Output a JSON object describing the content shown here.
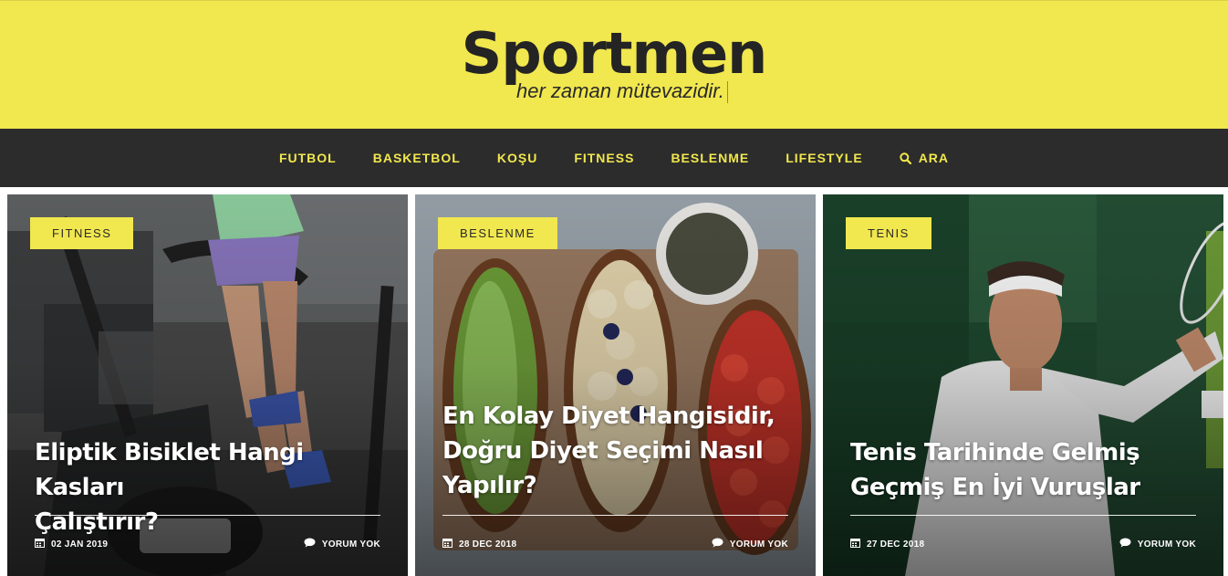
{
  "header": {
    "logo": "Sportmen",
    "tagline": "her zaman mütevazidir."
  },
  "nav": {
    "items": [
      "FUTBOL",
      "BASKETBOL",
      "KOŞU",
      "FITNESS",
      "BESLENME",
      "LIFESTYLE"
    ],
    "search_label": "ARA",
    "search_icon": "search-icon"
  },
  "cards": [
    {
      "category": "FITNESS",
      "title_line1": "Eliptik Bisiklet Hangi Kasları",
      "title_line2": "Çalıştırır?",
      "date": "02 JAN 2019",
      "comments": "YORUM YOK",
      "image": "woman-on-elliptical-machine-in-gym"
    },
    {
      "category": "BESLENME",
      "title_line1": "En Kolay Diyet Hangisidir,",
      "title_line2": "Doğru Diyet Seçimi Nasıl",
      "title_line3": "Yapılır?",
      "date": "28 DEC 2018",
      "comments": "YORUM YOK",
      "image": "avocado-banana-tomato-toasts-on-board"
    },
    {
      "category": "TENIS",
      "title_line1": "Tenis Tarihinde Gelmiş",
      "title_line2": "Geçmiş En İyi Vuruşlar",
      "date": "27 DEC 2018",
      "comments": "YORUM YOK",
      "image": "tennis-player-in-white-headband"
    }
  ],
  "colors": {
    "accent": "#f1e74e",
    "nav_bg": "#2c2c2c",
    "text_dark": "#242424"
  }
}
